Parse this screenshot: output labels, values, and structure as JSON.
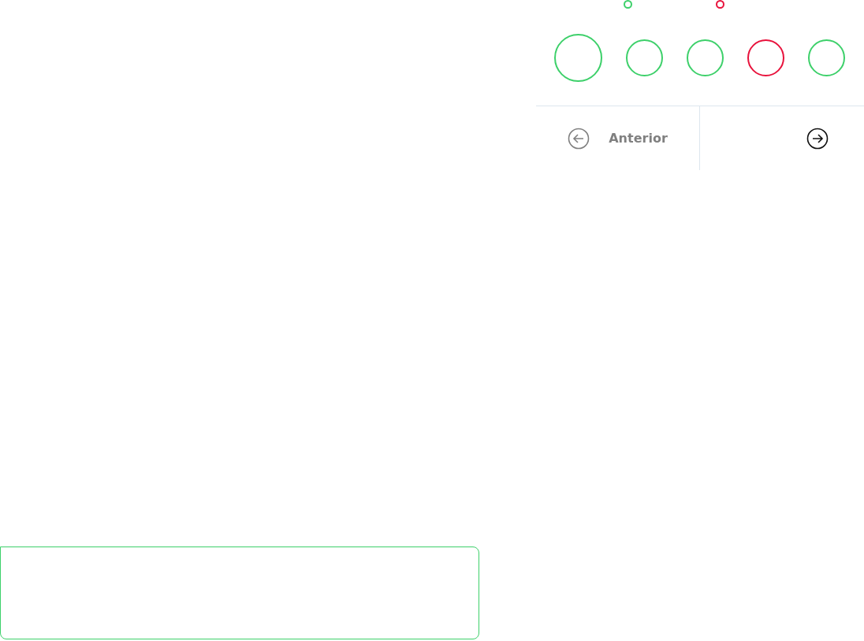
{
  "markers": [
    {
      "color": "#3dd06a"
    },
    {
      "color": "#e8123c"
    }
  ],
  "questions": [
    {
      "color": "#3dd06a",
      "selected": true
    },
    {
      "color": "#3dd06a",
      "selected": false
    },
    {
      "color": "#3dd06a",
      "selected": false
    },
    {
      "color": "#e8123c",
      "selected": false
    },
    {
      "color": "#3dd06a",
      "selected": false
    }
  ],
  "navigation": {
    "previous": {
      "label": "Anterior",
      "disabled": true
    },
    "next": {
      "disabled": false
    }
  },
  "answer_box": {
    "color": "#3dd06a"
  }
}
